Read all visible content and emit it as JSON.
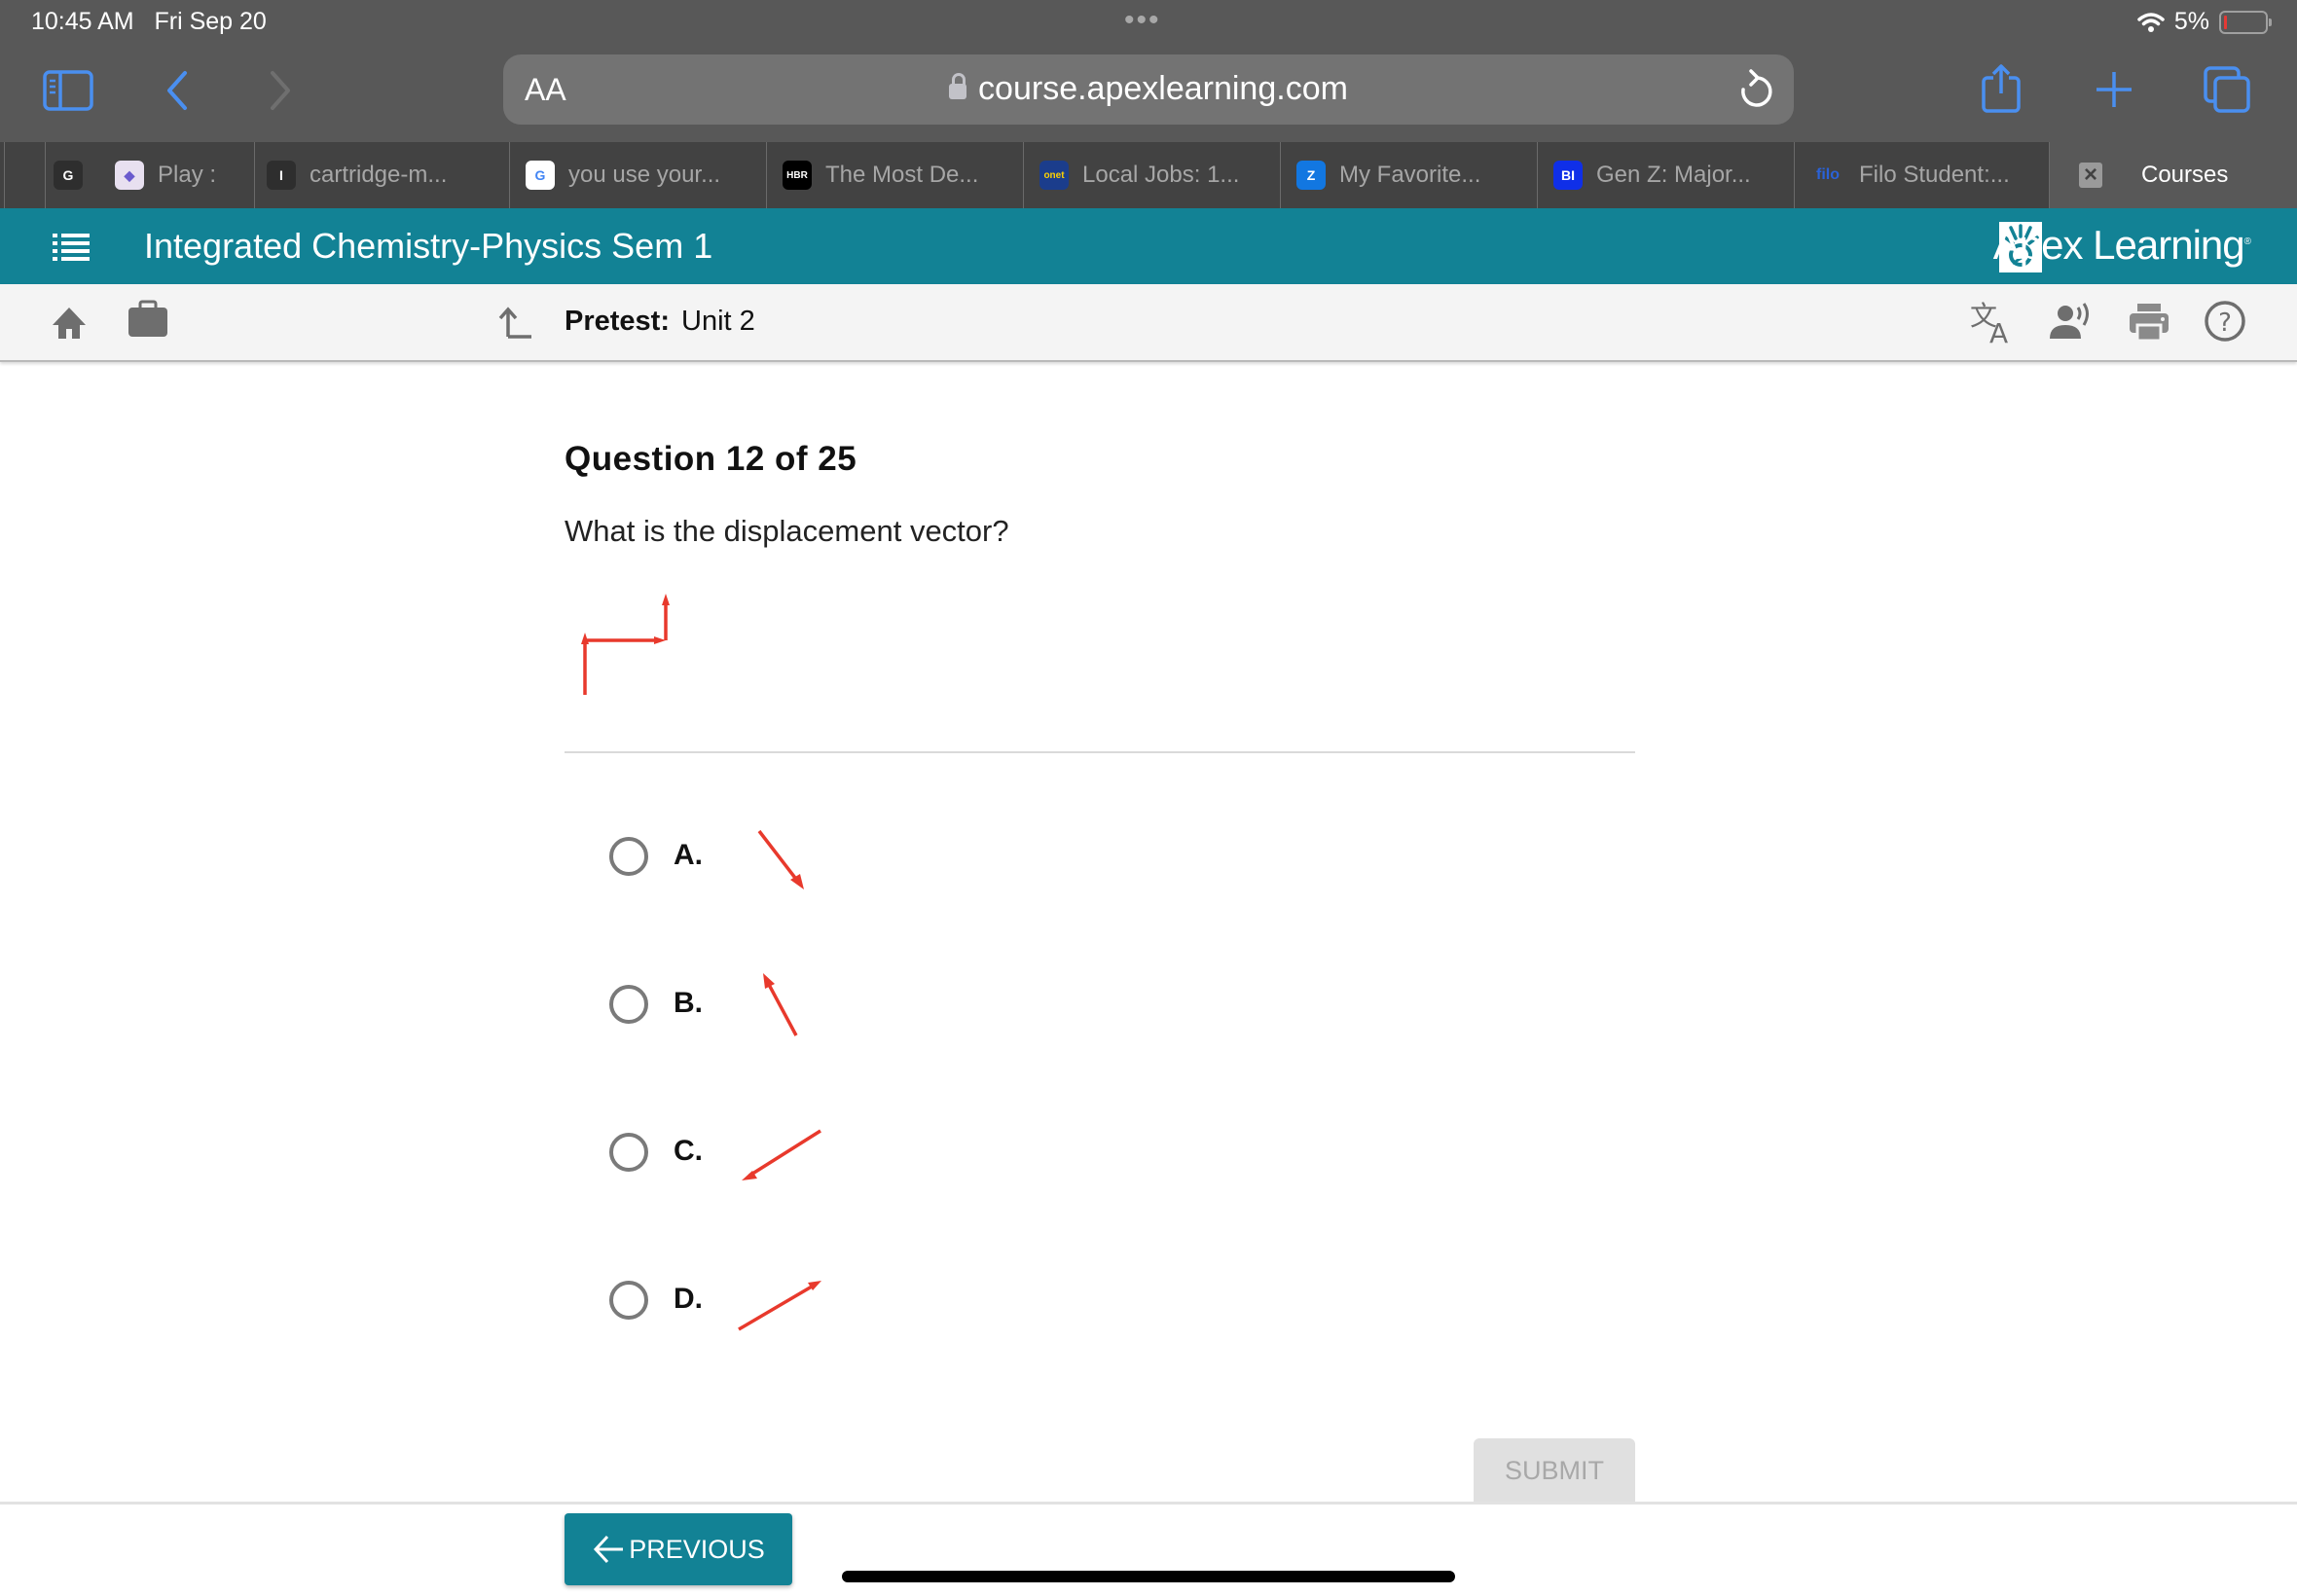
{
  "status_bar": {
    "time": "10:45 AM",
    "date": "Fri Sep 20",
    "battery_percent": "5%",
    "battery_level": 0.05
  },
  "browser": {
    "text_size_label": "AA",
    "url": "course.apexlearning.com",
    "icons": [
      "sidebar-icon",
      "back-icon",
      "forward-icon",
      "lock-icon",
      "reload-icon",
      "share-icon",
      "new-tab-icon",
      "tabs-icon"
    ]
  },
  "tabs": [
    {
      "label": "",
      "favicon": "G",
      "fav_bg": "#2e2e2e",
      "fav_color": "#ffffff"
    },
    {
      "label": "Play :",
      "favicon": "◆",
      "fav_bg": "#e8e0f0",
      "fav_color": "#6a5acd"
    },
    {
      "label": "cartridge-m...",
      "favicon": "I",
      "fav_bg": "#2e2e2e",
      "fav_color": "#ffffff"
    },
    {
      "label": "you use your...",
      "favicon": "G",
      "fav_bg": "#ffffff",
      "fav_color": "#4285f4"
    },
    {
      "label": "The Most De...",
      "favicon": "HBR",
      "fav_bg": "#000000",
      "fav_color": "#ffffff"
    },
    {
      "label": "Local Jobs: 1...",
      "favicon": "onet",
      "fav_bg": "#1b3d8c",
      "fav_color": "#ffd200"
    },
    {
      "label": "My Favorite...",
      "favicon": "Z",
      "fav_bg": "#1277e1",
      "fav_color": "#ffffff"
    },
    {
      "label": "Gen Z: Major...",
      "favicon": "BI",
      "fav_bg": "#0f2fe8",
      "fav_color": "#ffffff"
    },
    {
      "label": "Filo Student:...",
      "favicon": "filo",
      "fav_bg": "transparent",
      "fav_color": "#2a62d8"
    },
    {
      "label": "Courses",
      "favicon": "×",
      "fav_bg": "#9a9a9a",
      "fav_color": "#424242",
      "active": true
    }
  ],
  "app_header": {
    "course_title": "Integrated Chemistry-Physics Sem 1",
    "logo_text": "Apex Learning",
    "logo_mark": "®"
  },
  "subnav": {
    "pretest_label": "Pretest:",
    "unit": "Unit 2",
    "tools": [
      "translate-icon",
      "read-aloud-icon",
      "print-icon",
      "help-icon"
    ]
  },
  "question": {
    "title": "Question 12 of 25",
    "prompt": "What is the displacement vector?",
    "figure": "path of three vectors: up, right, up"
  },
  "options": [
    {
      "letter": "A.",
      "vector": "down-right",
      "angle_deg": -52
    },
    {
      "letter": "B.",
      "vector": "up-left",
      "angle_deg": 118
    },
    {
      "letter": "C.",
      "vector": "down-left",
      "angle_deg": 212
    },
    {
      "letter": "D.",
      "vector": "up-right",
      "angle_deg": 32
    }
  ],
  "actions": {
    "submit_label": "SUBMIT",
    "previous_label": "PREVIOUS"
  },
  "colors": {
    "brand": "#128295",
    "vector_red": "#e8392c",
    "ios_blue": "#4a8ff0"
  }
}
